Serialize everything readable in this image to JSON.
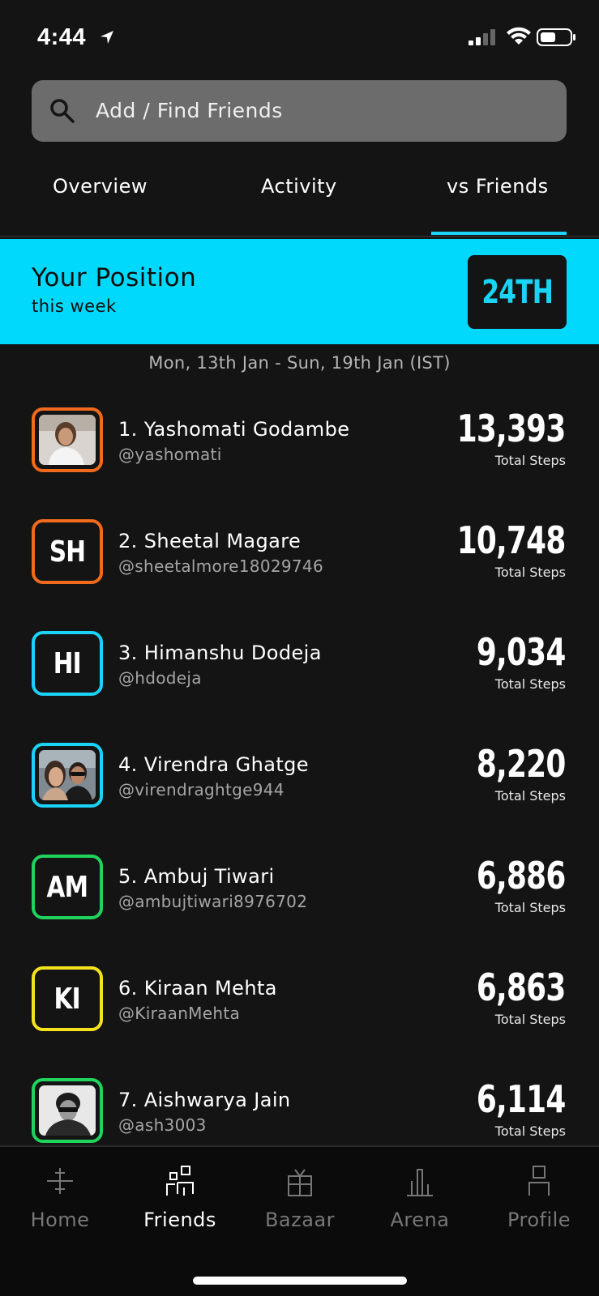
{
  "status": {
    "time": "4:44"
  },
  "search": {
    "placeholder": "Add / Find Friends"
  },
  "tabs": [
    {
      "label": "Overview",
      "active": false
    },
    {
      "label": "Activity",
      "active": false
    },
    {
      "label": "vs Friends",
      "active": true
    }
  ],
  "position": {
    "title": "Your Position",
    "subtitle": "this week",
    "rank": "24TH"
  },
  "date_range": "Mon, 13th Jan - Sun, 19th Jan (IST)",
  "steps_label": "Total Steps",
  "leaderboard": [
    {
      "name": "1. Yashomati Godambe",
      "handle": "@yashomati",
      "steps": "13,393",
      "avatar": "photo",
      "border": "#f26b1d"
    },
    {
      "name": "2. Sheetal Magare",
      "handle": "@sheetalmore18029746",
      "steps": "10,748",
      "avatar": "SH",
      "border": "#f26b1d"
    },
    {
      "name": "3. Himanshu Dodeja",
      "handle": "@hdodeja",
      "steps": "9,034",
      "avatar": "HI",
      "border": "#1ad3f7"
    },
    {
      "name": "4. Virendra Ghatge",
      "handle": "@virendraghtge944",
      "steps": "8,220",
      "avatar": "photo",
      "border": "#1ad3f7"
    },
    {
      "name": "5. Ambuj Tiwari",
      "handle": "@ambujtiwari8976702",
      "steps": "6,886",
      "avatar": "AM",
      "border": "#1fd35c"
    },
    {
      "name": "6. Kiraan Mehta",
      "handle": "@KiraanMehta",
      "steps": "6,863",
      "avatar": "KI",
      "border": "#f5e21c"
    },
    {
      "name": "7. Aishwarya Jain",
      "handle": "@ash3003",
      "steps": "6,114",
      "avatar": "photo",
      "border": "#1fd35c"
    }
  ],
  "nav": [
    {
      "label": "Home",
      "icon": "compass-icon",
      "active": false
    },
    {
      "label": "Friends",
      "icon": "friends-icon",
      "active": true
    },
    {
      "label": "Bazaar",
      "icon": "gift-icon",
      "active": false
    },
    {
      "label": "Arena",
      "icon": "arena-icon",
      "active": false
    },
    {
      "label": "Profile",
      "icon": "profile-icon",
      "active": false
    }
  ],
  "colors": {
    "accent": "#1ad3f7",
    "background": "#141414",
    "banner": "#00d9fb"
  }
}
